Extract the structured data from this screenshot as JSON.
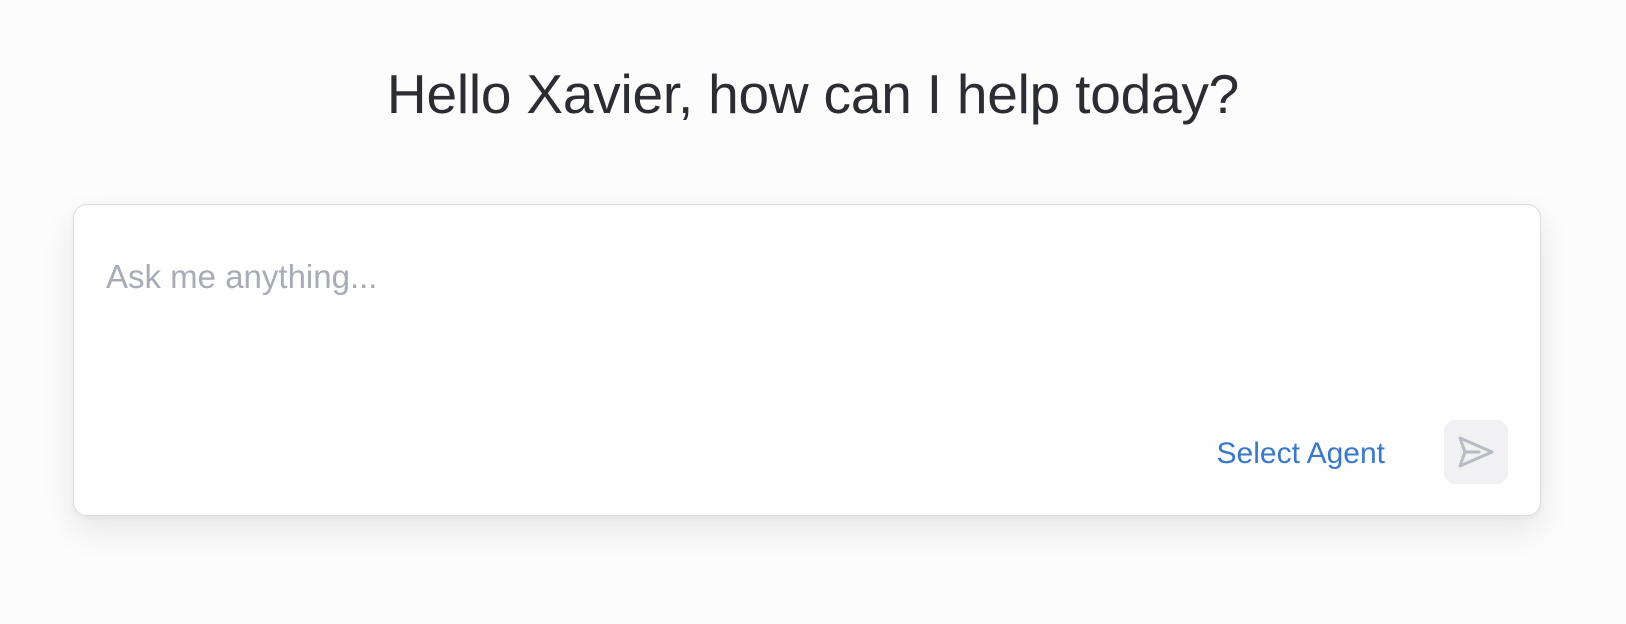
{
  "greeting": "Hello Xavier, how can I help today?",
  "composer": {
    "placeholder": "Ask me anything...",
    "value": "",
    "select_agent_label": "Select Agent",
    "send_icon": "send-icon",
    "send_enabled": false
  },
  "colors": {
    "background": "#fcfcfd",
    "heading": "#2c2d33",
    "placeholder": "#a9acb6",
    "accent": "#3a78c9",
    "send_button_bg": "#f1f1f3",
    "send_icon": "#b8bbc3"
  }
}
